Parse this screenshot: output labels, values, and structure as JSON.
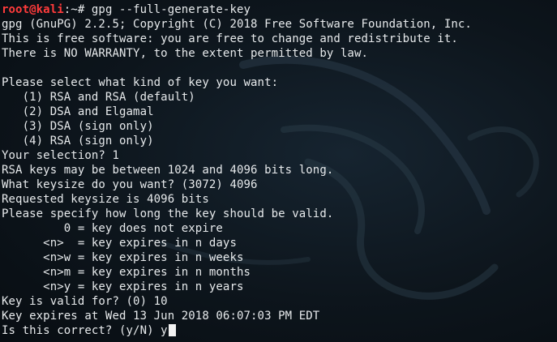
{
  "terminal": {
    "prompt": {
      "user_host": "root@kali",
      "path_suffix": ":~# ",
      "command": "gpg --full-generate-key"
    },
    "output_lines": [
      "gpg (GnuPG) 2.2.5; Copyright (C) 2018 Free Software Foundation, Inc.",
      "This is free software: you are free to change and redistribute it.",
      "There is NO WARRANTY, to the extent permitted by law.",
      "",
      "Please select what kind of key you want:",
      "   (1) RSA and RSA (default)",
      "   (2) DSA and Elgamal",
      "   (3) DSA (sign only)",
      "   (4) RSA (sign only)",
      "Your selection? 1",
      "RSA keys may be between 1024 and 4096 bits long.",
      "What keysize do you want? (3072) 4096",
      "Requested keysize is 4096 bits",
      "Please specify how long the key should be valid.",
      "         0 = key does not expire",
      "      <n>  = key expires in n days",
      "      <n>w = key expires in n weeks",
      "      <n>m = key expires in n months",
      "      <n>y = key expires in n years",
      "Key is valid for? (0) 10",
      "Key expires at Wed 13 Jun 2018 06:07:03 PM EDT"
    ],
    "current_input": {
      "question": "Is this correct? (y/N) ",
      "typed": "y"
    },
    "colors": {
      "background": "#0b1117",
      "text": "#e7eaec",
      "prompt_user": "#ff3b3b"
    }
  }
}
